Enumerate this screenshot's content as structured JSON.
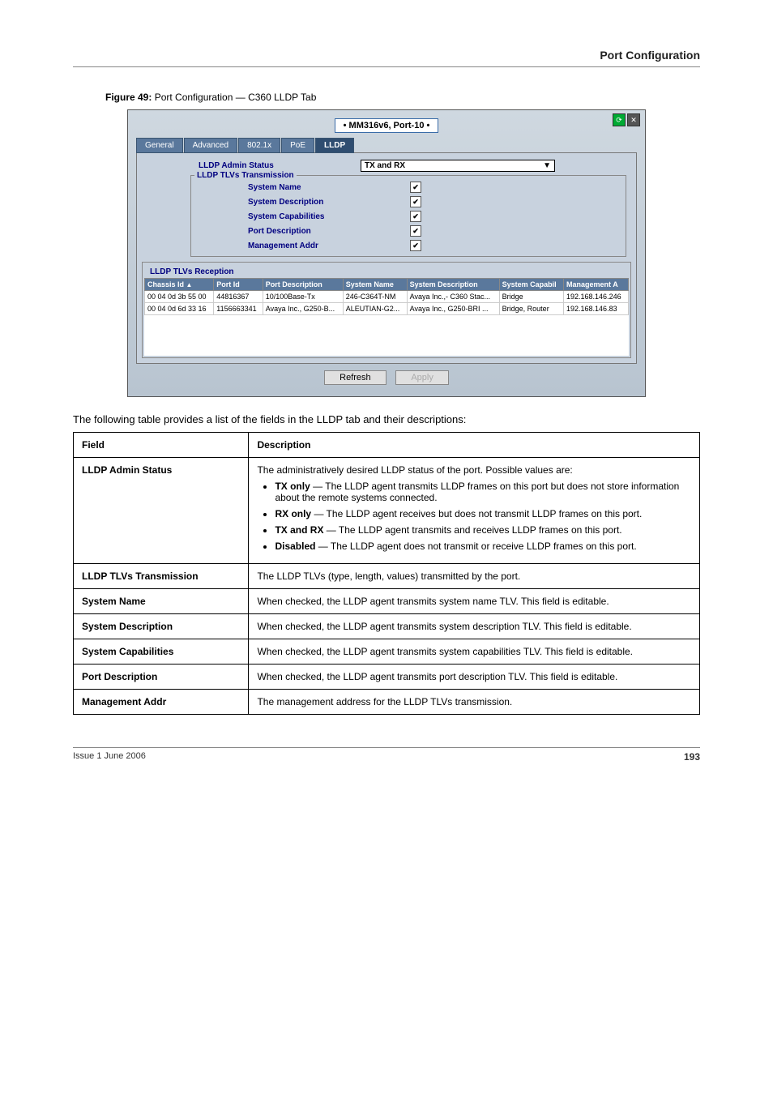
{
  "header_right": "Port Configuration",
  "figure_label_prefix": "Figure 49: ",
  "figure_label": "Port Configuration — C360 LLDP Tab",
  "screenshot": {
    "title": "• MM316v6, Port-10 •",
    "tabs": [
      "General",
      "Advanced",
      "802.1x",
      "PoE",
      "LLDP"
    ],
    "active_tab": 4,
    "admin_status_label": "LLDP Admin Status",
    "admin_status_value": "TX and RX",
    "tx_section_label": "LLDP TLVs Transmission",
    "tx_rows": [
      {
        "label": "System Name",
        "checked": true
      },
      {
        "label": "System Description",
        "checked": true
      },
      {
        "label": "System Capabilities",
        "checked": true
      },
      {
        "label": "Port Description",
        "checked": true
      },
      {
        "label": "Management Addr",
        "checked": true
      }
    ],
    "rx_section_label": "LLDP TLVs Reception",
    "rx_headers": [
      "Chassis Id",
      "Port Id",
      "Port Description",
      "System Name",
      "System Description",
      "System Capabil",
      "Management A"
    ],
    "rx_rows": [
      {
        "chassis": "00 04 0d 3b 55 00",
        "port": "44816367",
        "pdesc": "10/100Base-Tx",
        "sname": "246-C364T-NM",
        "sdesc": "Avaya Inc.,- C360 Stac...",
        "scap": "Bridge",
        "maddr": "192.168.146.246"
      },
      {
        "chassis": "00 04 0d 6d 33 16",
        "port": "1156663341",
        "pdesc": "Avaya Inc., G250-B...",
        "sname": "ALEUTIAN-G2...",
        "sdesc": "Avaya Inc., G250-BRI ...",
        "scap": "Bridge, Router",
        "maddr": "192.168.146.83"
      }
    ],
    "buttons": {
      "refresh": "Refresh",
      "apply": "Apply"
    }
  },
  "table_intro": "The following table provides a list of the fields in the LLDP tab and their descriptions:",
  "fields_table": {
    "headers": [
      "Field",
      "Description"
    ],
    "rows": [
      {
        "field": "LLDP Admin Status",
        "desc_intro": "The administratively desired LLDP status of the port. Possible values are:",
        "bullets": [
          {
            "strong": "TX only",
            "text": " — The LLDP agent transmits LLDP frames on this port but does not store information about the remote systems connected."
          },
          {
            "strong": "RX only",
            "text": " — The LLDP agent receives but does not transmit LLDP frames on this port."
          },
          {
            "strong": "TX and RX",
            "text": " — The LLDP agent transmits and receives LLDP frames on this port."
          },
          {
            "strong": "Disabled",
            "text": " — The LLDP agent does not transmit or receive LLDP frames on this port."
          }
        ]
      },
      {
        "field": "LLDP TLVs Transmission",
        "plain": "The LLDP TLVs (type, length, values) transmitted by the port."
      },
      {
        "field": "System Name",
        "plain": "When checked, the LLDP agent transmits system name TLV. This field is editable."
      },
      {
        "field": "System Description",
        "plain": "When checked, the LLDP agent transmits system description TLV. This field is editable."
      },
      {
        "field": "System Capabilities",
        "plain": "When checked, the LLDP agent transmits system capabilities TLV. This field is editable."
      },
      {
        "field": "Port Description",
        "plain": "When checked, the LLDP agent transmits port description TLV. This field is editable."
      },
      {
        "field": "Management Addr",
        "plain": "The management address for the LLDP TLVs transmission."
      }
    ]
  },
  "footer": {
    "left": "Issue 1 June 2006",
    "right": "193"
  }
}
